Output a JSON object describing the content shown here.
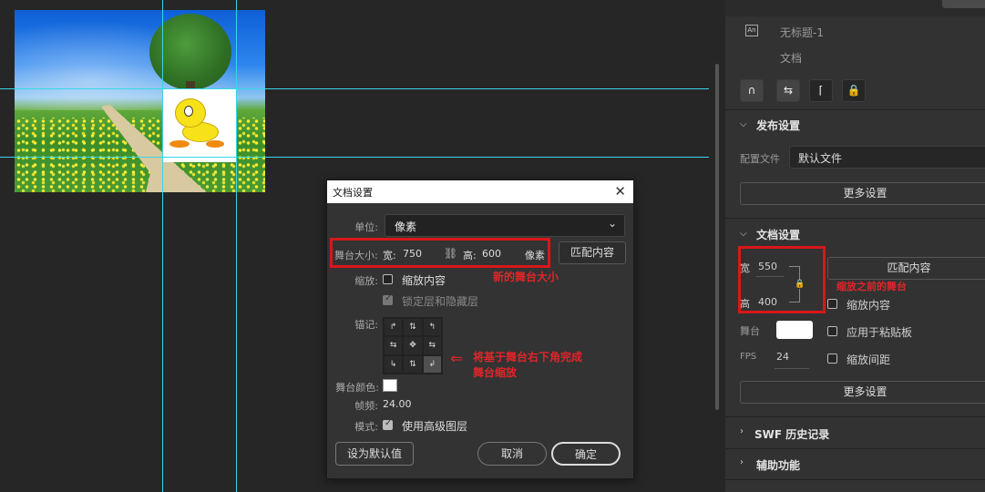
{
  "dialog": {
    "title": "文档设置",
    "unit_label": "单位:",
    "unit_value": "像素",
    "stage_size_label": "舞台大小:",
    "width_label": "宽:",
    "width_value": "750",
    "height_label": "高:",
    "height_value": "600",
    "size_unit": "像素",
    "match_content": "匹配内容",
    "new_size_note": "新的舞台大小",
    "scale_label": "缩放:",
    "scale_content": "缩放内容",
    "lock_layers": "锁定层和隐藏层",
    "anchor_label": "锚记:",
    "anchor_glyphs": [
      "↱",
      "⇅",
      "↰",
      "⇆",
      "✥",
      "⇆",
      "↳",
      "⇅",
      "↲"
    ],
    "anchor_note_line1": "将基于舞台右下角完成",
    "anchor_note_line2": "舞台缩放",
    "stage_color_label": "舞台颜色:",
    "frame_rate_label": "帧频:",
    "frame_rate_value": "24.00",
    "mode_label": "模式:",
    "advanced_layers": "使用高级图层",
    "set_default": "设为默认值",
    "cancel": "取消",
    "ok": "确定"
  },
  "panel": {
    "doc_name": "无标题-1",
    "doc_type": "文档",
    "an_badge": "An",
    "publish_section": "发布设置",
    "profile_label": "配置文件",
    "profile_value": "默认文件",
    "more_settings": "更多设置",
    "doc_settings_section": "文档设置",
    "width_label": "宽",
    "width_value": "550",
    "height_label": "高",
    "height_value": "400",
    "match_content": "匹配内容",
    "before_note": "缩放之前的舞台",
    "scale_content": "缩放内容",
    "stage_label": "舞台",
    "apply_pasteboard": "应用于粘贴板",
    "fps_label": "FPS",
    "fps_value": "24",
    "scale_spacing": "缩放间距",
    "more_settings_2": "更多设置",
    "swf_history": "SWF 历史记录",
    "accessibility": "辅助功能",
    "tools": [
      "∩",
      "⇆",
      "⌈",
      "🔒"
    ]
  },
  "colors": {
    "annotation_red": "#d8171a",
    "guide_cyan": "#37d6e6",
    "panel_bg": "#323232",
    "canvas_bg": "#262626"
  }
}
